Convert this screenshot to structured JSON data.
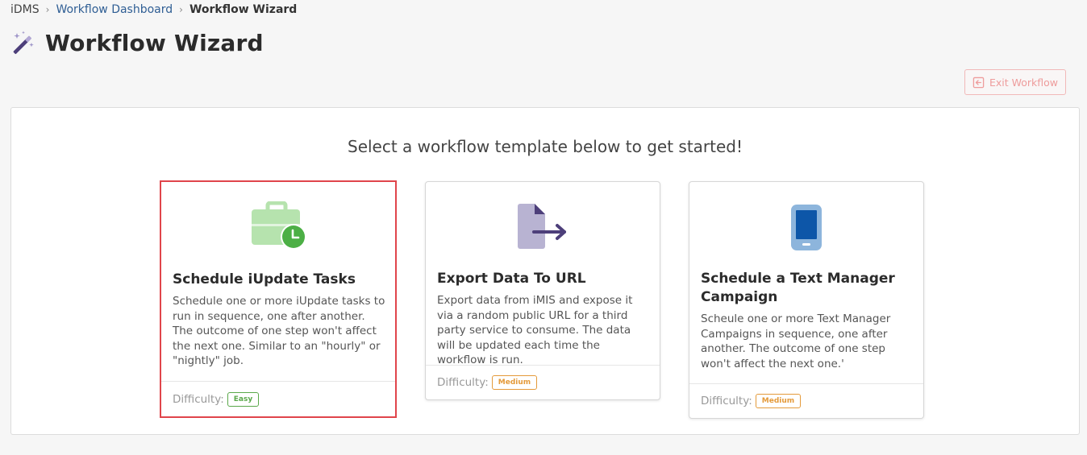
{
  "breadcrumb": {
    "root": "iDMS",
    "parent": "Workflow Dashboard",
    "current": "Workflow Wizard"
  },
  "page": {
    "title": "Workflow Wizard",
    "title_icon": "magic-wand-icon"
  },
  "toolbar": {
    "exit_label": "Exit Workflow",
    "exit_icon": "sign-out-icon"
  },
  "panel": {
    "prompt": "Select a workflow template below to get started!"
  },
  "templates": [
    {
      "title": "Schedule iUpdate Tasks",
      "description": "Schedule one or more iUpdate tasks to run in sequence, one after another. The outcome of one step won't affect the next one. Similar to an \"hourly\" or \"nightly\" job.",
      "difficulty_label": "Difficulty:",
      "difficulty": "Easy",
      "icon": "briefcase-clock-icon",
      "selected": true
    },
    {
      "title": "Export Data To URL",
      "description": "Export data from iMIS and expose it via a random public URL for a third party service to consume. The data will be updated each time the workflow is run.",
      "difficulty_label": "Difficulty:",
      "difficulty": "Medium",
      "icon": "file-export-icon",
      "selected": false
    },
    {
      "title": "Schedule a Text Manager Campaign",
      "description": "Scheule one or more Text Manager Campaigns in sequence, one after another. The outcome of one step won't affect the next one.'",
      "difficulty_label": "Difficulty:",
      "difficulty": "Medium",
      "icon": "mobile-phone-icon",
      "selected": false
    }
  ],
  "colors": {
    "selected_border": "#e0454b",
    "easy": "#5aa84a",
    "medium": "#e49a3a",
    "link": "#2f5e94",
    "exit": "#ee9c9c"
  }
}
